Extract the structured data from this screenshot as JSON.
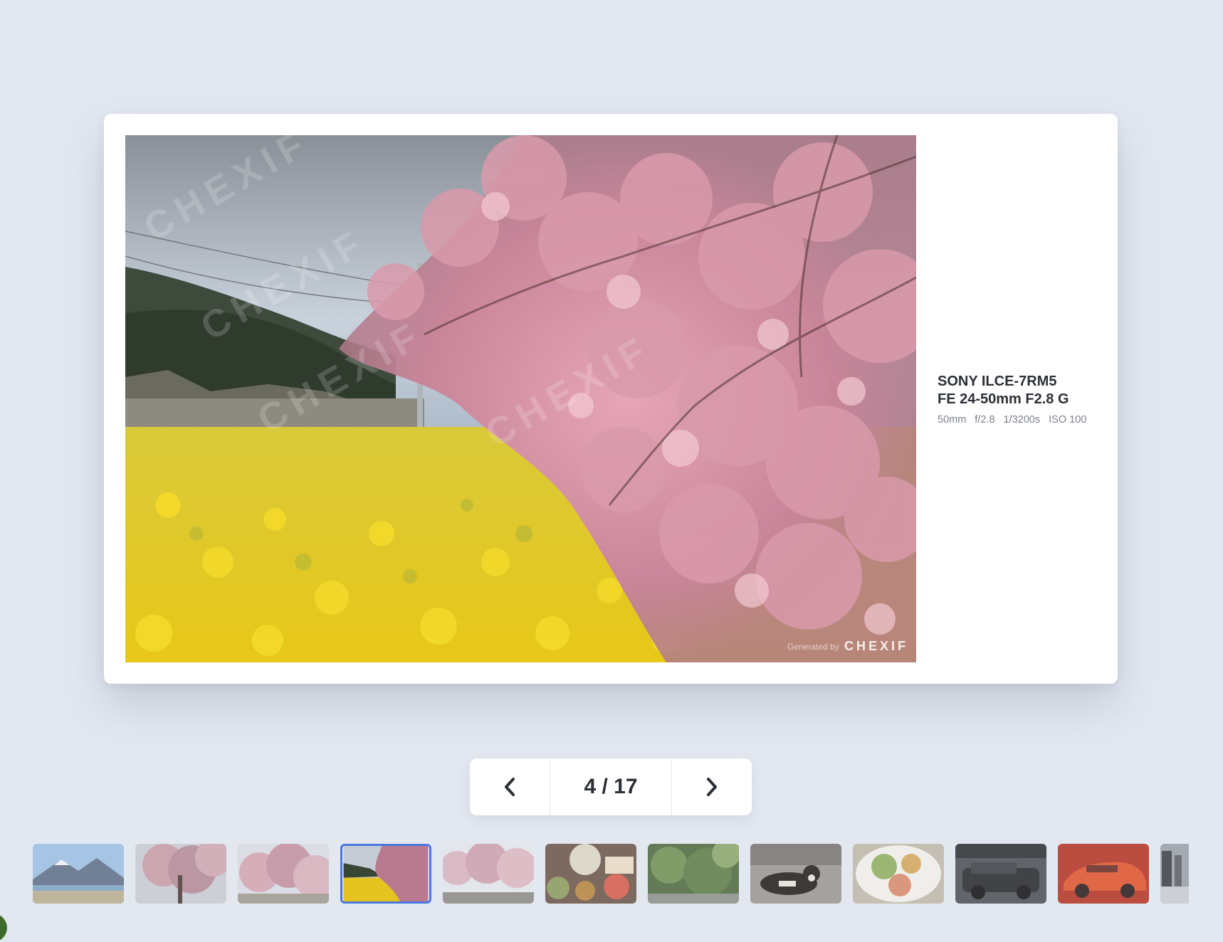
{
  "photo": {
    "watermark_text": "CHEXIF",
    "signature_prefix": "Generated by",
    "signature_brand": "CHEXIF"
  },
  "exif": {
    "camera": "SONY ILCE-7RM5",
    "lens": "FE 24-50mm F2.8 G",
    "focal_length": "50mm",
    "aperture": "f/2.8",
    "shutter": "1/3200s",
    "iso": "ISO 100"
  },
  "pager": {
    "counter": "4 / 17",
    "prev_icon": "chevron-left-icon",
    "next_icon": "chevron-right-icon"
  },
  "thumbnails": {
    "active_index": 3,
    "items": [
      {
        "subject": "mountain-lake"
      },
      {
        "subject": "cherry-tree"
      },
      {
        "subject": "cherry-tree-sky"
      },
      {
        "subject": "rapeseed-cherry"
      },
      {
        "subject": "cherry-blossoms"
      },
      {
        "subject": "food-tray"
      },
      {
        "subject": "green-plants"
      },
      {
        "subject": "dog"
      },
      {
        "subject": "food-plate"
      },
      {
        "subject": "dark-suv"
      },
      {
        "subject": "red-car"
      },
      {
        "subject": "street"
      }
    ]
  },
  "colors": {
    "accent": "#4a78e0",
    "background": "#e3e8f0",
    "text": "#2b2f36",
    "muted": "#7b8089"
  }
}
